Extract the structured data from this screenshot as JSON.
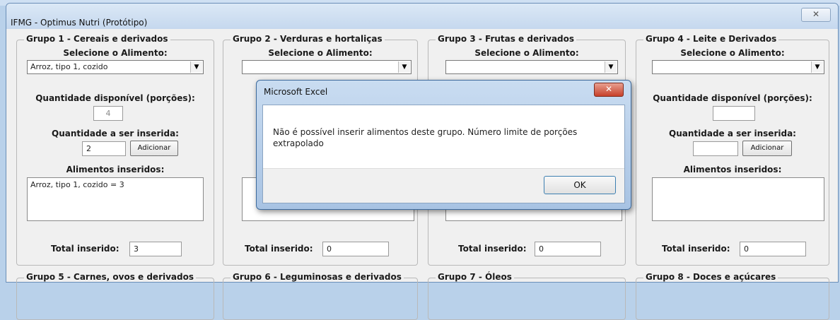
{
  "window": {
    "title": "IFMG - Optimus Nutri (Protótipo)",
    "close_glyph": "✕"
  },
  "groups_top": [
    {
      "title": "Grupo 1 - Cereais e derivados",
      "select_label": "Selecione o Alimento:",
      "selected": "Arroz, tipo 1, cozido",
      "avail_label": "Quantidade disponível (porções):",
      "avail_value": "4",
      "insert_label": "Quantidade a ser inserida:",
      "insert_value": "2",
      "add_label": "Adicionar",
      "list_label": "Alimentos inseridos:",
      "list_items": [
        "Arroz, tipo 1, cozido = 3"
      ],
      "total_label": "Total inserido:",
      "total_value": "3"
    },
    {
      "title": "Grupo 2 - Verduras e hortaliças",
      "select_label": "Selecione o Alimento:",
      "selected": "",
      "total_label": "Total inserido:",
      "total_value": "0"
    },
    {
      "title": "Grupo 3 - Frutas e derivados",
      "select_label": "Selecione o Alimento:",
      "selected": "",
      "total_label": "Total inserido:",
      "total_value": "0"
    },
    {
      "title": "Grupo 4 - Leite e Derivados",
      "select_label": "Selecione o Alimento:",
      "selected": "",
      "avail_label": "Quantidade disponível (porções):",
      "avail_value": "",
      "insert_label": "Quantidade a ser inserida:",
      "insert_value": "",
      "add_label": "Adicionar",
      "list_label": "Alimentos inseridos:",
      "list_items": [],
      "total_label": "Total inserido:",
      "total_value": "0"
    }
  ],
  "groups_bottom": [
    {
      "title": "Grupo 5 - Carnes, ovos e derivados"
    },
    {
      "title": "Grupo 6 - Leguminosas e derivados"
    },
    {
      "title": "Grupo 7 - Óleos"
    },
    {
      "title": "Grupo 8 - Doces e açúcares"
    }
  ],
  "dialog": {
    "title": "Microsoft Excel",
    "close_glyph": "✕",
    "message": "Não é possível inserir alimentos deste grupo. Número limite de porções extrapolado",
    "ok_label": "OK"
  },
  "icons": {
    "dropdown": "▼"
  }
}
